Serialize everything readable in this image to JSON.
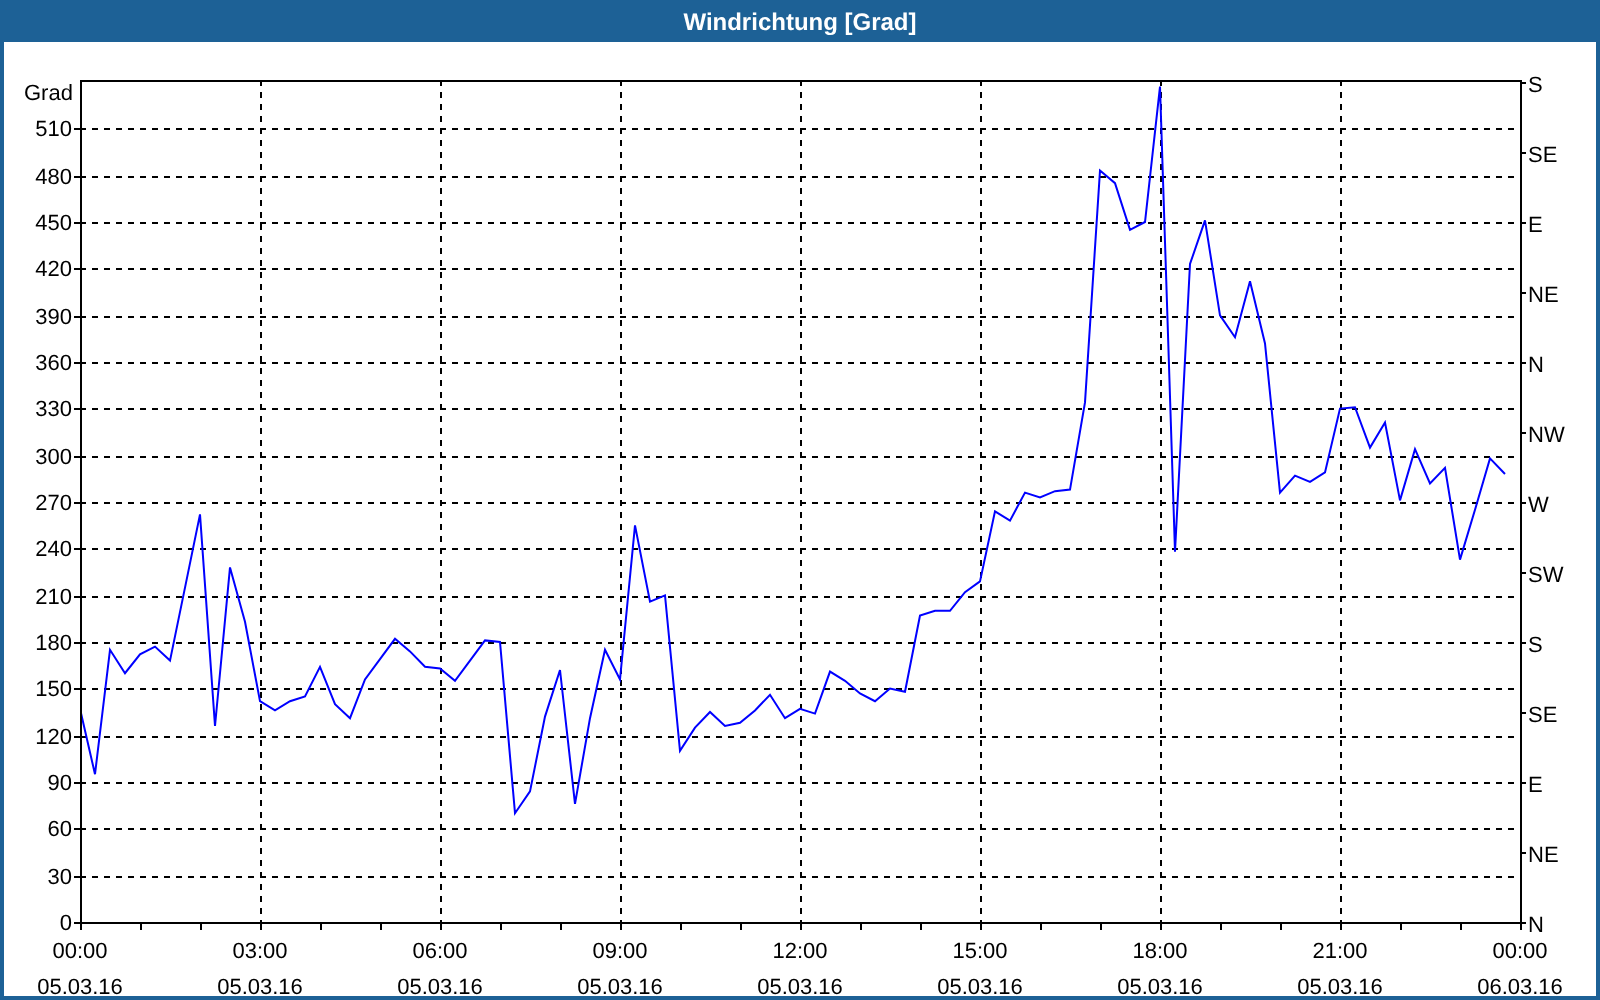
{
  "window": {
    "title": "Windrichtung [Grad]"
  },
  "chart": {
    "right_axis": {
      "labels": [
        "S",
        "SE",
        "E",
        "NE",
        "N",
        "NW",
        "W",
        "SW",
        "S",
        "SE",
        "E",
        "NE",
        "N"
      ]
    },
    "chart_data": {
      "type": "line",
      "grid": true,
      "ylabel": "Grad",
      "ylim": [
        0,
        540
      ],
      "yticks": [
        0,
        30,
        60,
        90,
        120,
        150,
        180,
        210,
        240,
        270,
        300,
        330,
        360,
        390,
        420,
        450,
        480,
        510
      ],
      "categories": [
        "00:00 05.03.16",
        null,
        null,
        null,
        null,
        null,
        null,
        null,
        null,
        null,
        null,
        null,
        "03:00 05.03.16",
        null,
        null,
        null,
        null,
        null,
        null,
        null,
        null,
        null,
        null,
        null,
        "06:00 05.03.16",
        null,
        null,
        null,
        null,
        null,
        null,
        null,
        null,
        null,
        null,
        null,
        "09:00 05.03.16",
        null,
        null,
        null,
        null,
        null,
        null,
        null,
        null,
        null,
        null,
        null,
        "12:00 05.03.16",
        null,
        null,
        null,
        null,
        null,
        null,
        null,
        null,
        null,
        null,
        null,
        "15:00 05.03.16",
        null,
        null,
        null,
        null,
        null,
        null,
        null,
        null,
        null,
        null,
        null,
        "18:00 05.03.16",
        null,
        null,
        null,
        null,
        null,
        null,
        null,
        null,
        null,
        null,
        null,
        "21:00 05.03.16",
        null,
        null,
        null,
        null,
        null,
        null,
        null,
        null,
        null,
        null,
        null,
        "00:00 06.03.16"
      ],
      "series": [
        {
          "color": "#0000ff",
          "values": [
            137,
            95,
            175,
            160,
            172,
            177,
            168,
            215,
            262,
            126,
            228,
            193,
            142,
            136,
            142,
            145,
            164,
            140,
            131,
            156,
            169,
            182,
            174,
            164,
            163,
            155,
            168,
            181,
            180,
            70,
            84,
            132,
            162,
            76,
            131,
            175,
            156,
            255,
            206,
            210,
            110,
            125,
            135,
            126,
            128,
            136,
            146,
            131,
            137,
            134,
            161,
            155,
            147,
            142,
            150,
            148,
            197,
            200,
            200,
            212,
            219,
            264,
            258,
            276,
            273,
            277,
            278,
            334,
            483,
            475,
            445,
            450,
            537,
            238,
            423,
            451,
            390,
            376,
            412,
            372,
            276,
            287,
            283,
            289,
            330,
            331,
            305,
            321,
            271,
            304,
            282,
            292,
            233,
            265,
            298,
            288,
            null
          ]
        }
      ]
    }
  }
}
